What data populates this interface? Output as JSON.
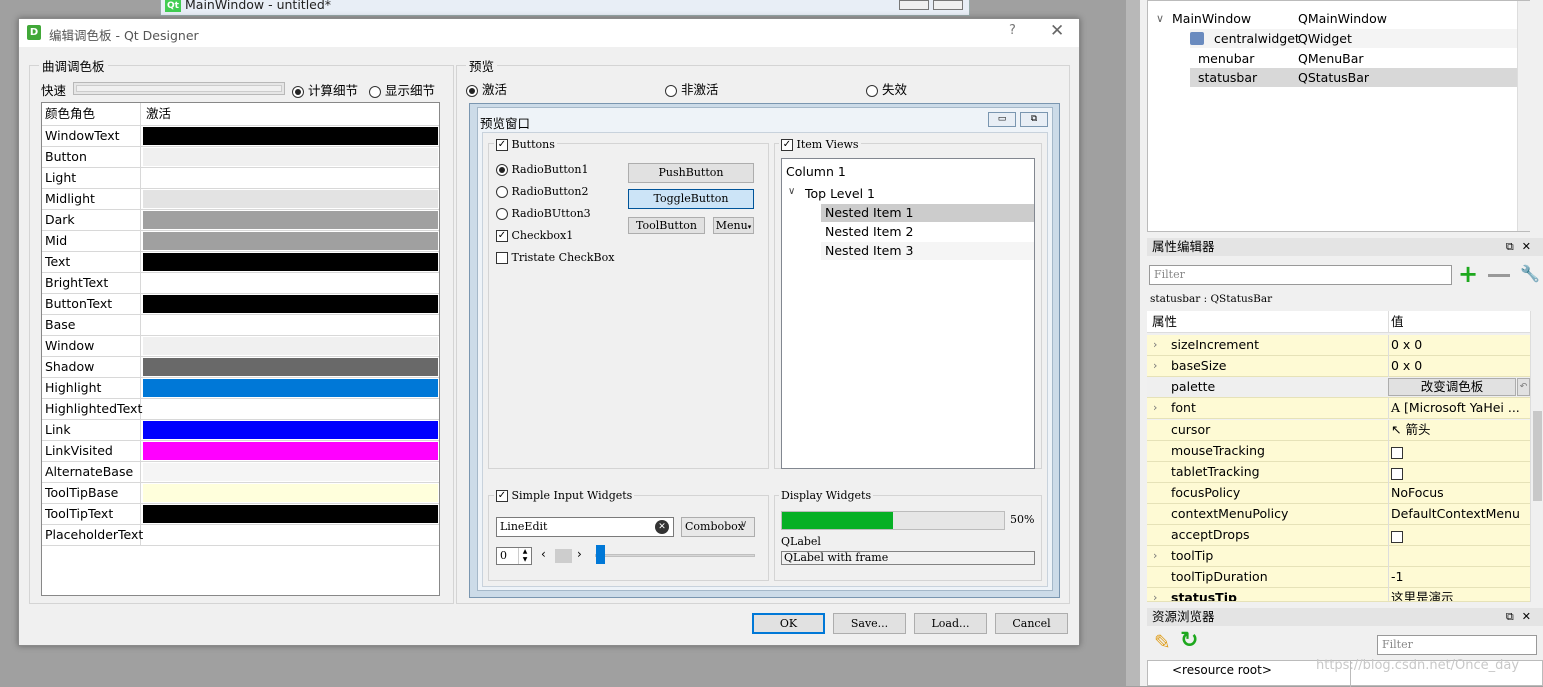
{
  "background_window": {
    "title": "MainWindow - untitled*",
    "qt_badge": "Qt"
  },
  "object_tree": {
    "rows": [
      {
        "name": "MainWindow",
        "class": "QMainWindow"
      },
      {
        "name": "centralwidget",
        "class": "QWidget"
      },
      {
        "name": "menubar",
        "class": "QMenuBar"
      },
      {
        "name": "statusbar",
        "class": "QStatusBar"
      }
    ]
  },
  "property_editor": {
    "title": "属性编辑器",
    "filter_placeholder": "Filter",
    "object_label": "statusbar : QStatusBar",
    "col_property": "属性",
    "col_value": "值",
    "rows": [
      {
        "name": "sizeIncrement",
        "value": "0 x 0"
      },
      {
        "name": "baseSize",
        "value": "0 x 0"
      },
      {
        "name": "palette",
        "value": "改变调色板"
      },
      {
        "name": "font",
        "value": "[Microsoft YaHei ..."
      },
      {
        "name": "cursor",
        "value": "箭头"
      },
      {
        "name": "mouseTracking",
        "value": ""
      },
      {
        "name": "tabletTracking",
        "value": ""
      },
      {
        "name": "focusPolicy",
        "value": "NoFocus"
      },
      {
        "name": "contextMenuPolicy",
        "value": "DefaultContextMenu"
      },
      {
        "name": "acceptDrops",
        "value": ""
      },
      {
        "name": "toolTip",
        "value": ""
      },
      {
        "name": "toolTipDuration",
        "value": "-1"
      },
      {
        "name": "statusTip",
        "value": "这里是演示"
      }
    ]
  },
  "resource_browser": {
    "title": "资源浏览器",
    "filter_placeholder": "Filter",
    "root": "<resource root>"
  },
  "watermark": "https://blog.csdn.net/Once_day",
  "dialog": {
    "title": "编辑调色板 - Qt Designer",
    "help": "?",
    "close": "✕",
    "palette_group": "曲调调色板",
    "quick": "快速",
    "detail_calc": "计算细节",
    "detail_show": "显示细节",
    "table_header": {
      "role": "颜色角色",
      "active": "激活"
    },
    "roles": [
      {
        "name": "WindowText",
        "color": "#000000"
      },
      {
        "name": "Button",
        "color": "#f0f0f0"
      },
      {
        "name": "Light",
        "color": "#ffffff"
      },
      {
        "name": "Midlight",
        "color": "#e3e3e3"
      },
      {
        "name": "Dark",
        "color": "#a0a0a0"
      },
      {
        "name": "Mid",
        "color": "#a0a0a0"
      },
      {
        "name": "Text",
        "color": "#000000"
      },
      {
        "name": "BrightText",
        "color": "#ffffff"
      },
      {
        "name": "ButtonText",
        "color": "#000000"
      },
      {
        "name": "Base",
        "color": "#ffffff"
      },
      {
        "name": "Window",
        "color": "#f0f0f0"
      },
      {
        "name": "Shadow",
        "color": "#696969"
      },
      {
        "name": "Highlight",
        "color": "#0078d7"
      },
      {
        "name": "HighlightedText",
        "color": "#ffffff"
      },
      {
        "name": "Link",
        "color": "#0000ff"
      },
      {
        "name": "LinkVisited",
        "color": "#ff00ff"
      },
      {
        "name": "AlternateBase",
        "color": "#f5f5f5"
      },
      {
        "name": "ToolTipBase",
        "color": "#ffffdc"
      },
      {
        "name": "ToolTipText",
        "color": "#000000"
      },
      {
        "name": "PlaceholderText",
        "color": "#ffffff"
      }
    ],
    "preview_group": "预览",
    "mode_active": "激活",
    "mode_inactive": "非激活",
    "mode_disabled": "失效",
    "preview_window_title": "预览窗口",
    "buttons_group": "Buttons",
    "radio1": "RadioButton1",
    "radio2": "RadioButton2",
    "radio3": "RadioBUtton3",
    "checkbox1": "Checkbox1",
    "tristate": "Tristate CheckBox",
    "push": "PushButton",
    "toggle": "ToggleButton",
    "toolbutton": "ToolButton",
    "menu": "Menu",
    "item_views_group": "Item Views",
    "tree_header": "Column 1",
    "top_level": "Top Level 1",
    "nested": [
      "Nested Item 1",
      "Nested Item 2",
      "Nested Item 3"
    ],
    "simple_input_group": "Simple Input Widgets",
    "lineedit": "LineEdit",
    "combobox": "Combobox",
    "spin_value": "0",
    "display_group": "Display Widgets",
    "progress": 0.5,
    "progress_text": "50%",
    "qlabel": "QLabel",
    "qlabel_frame": "QLabel with frame",
    "btn_ok": "OK",
    "btn_save": "Save...",
    "btn_load": "Load...",
    "btn_cancel": "Cancel"
  }
}
